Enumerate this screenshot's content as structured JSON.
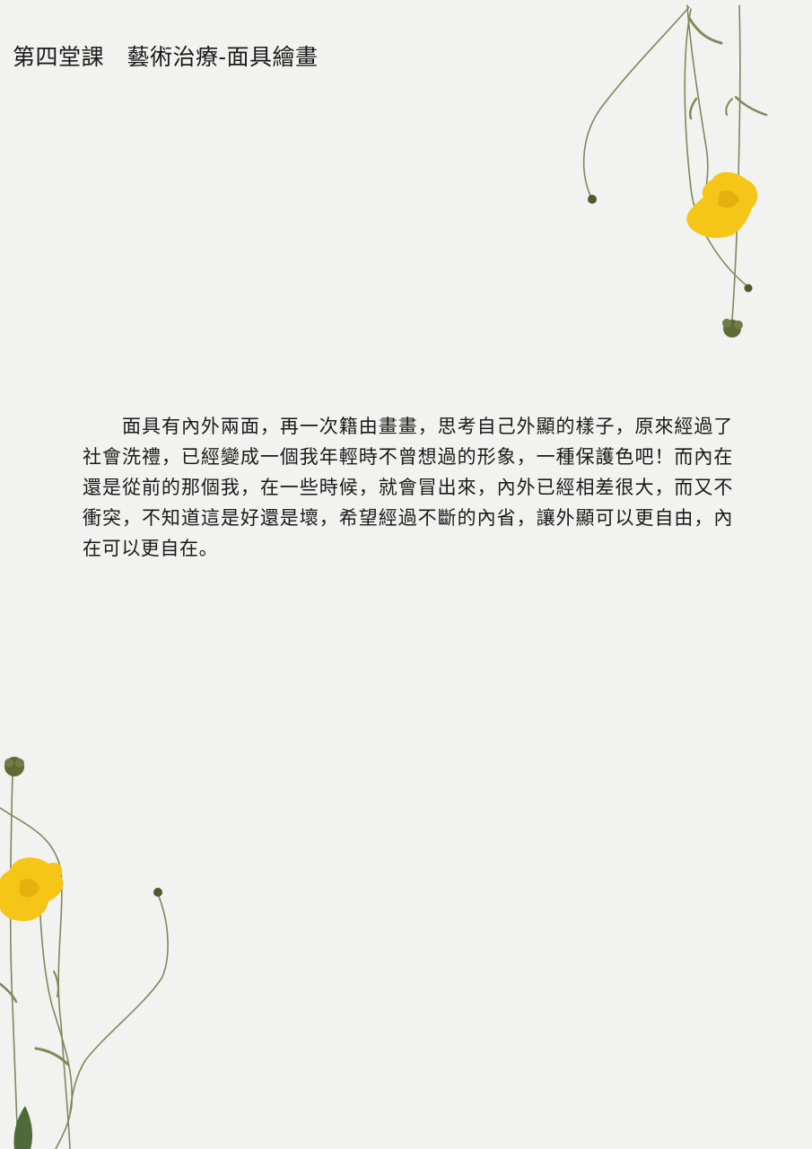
{
  "page": {
    "title": "第四堂課　藝術治療-面具繪畫",
    "paragraph": "面具有內外兩面，再一次籍由畫畫，思考自己外顯的樣子，原來經過了社會洗禮，已經變成一個我年輕時不曾想過的形象，一種保護色吧！而內在還是從前的那個我，在一些時候，就會冒出來，內外已經相差很大，而又不衝突，不知道這是好還是壞，希望經過不斷的內省，讓外顯可以更自由，內在可以更自在。"
  },
  "decorations": {
    "top_right": "pressed-flower-icon",
    "bottom_left": "pressed-flower-icon",
    "petal_color": "#f5c518",
    "stem_color": "#7d8a5a",
    "bud_color": "#4e5a2e"
  }
}
